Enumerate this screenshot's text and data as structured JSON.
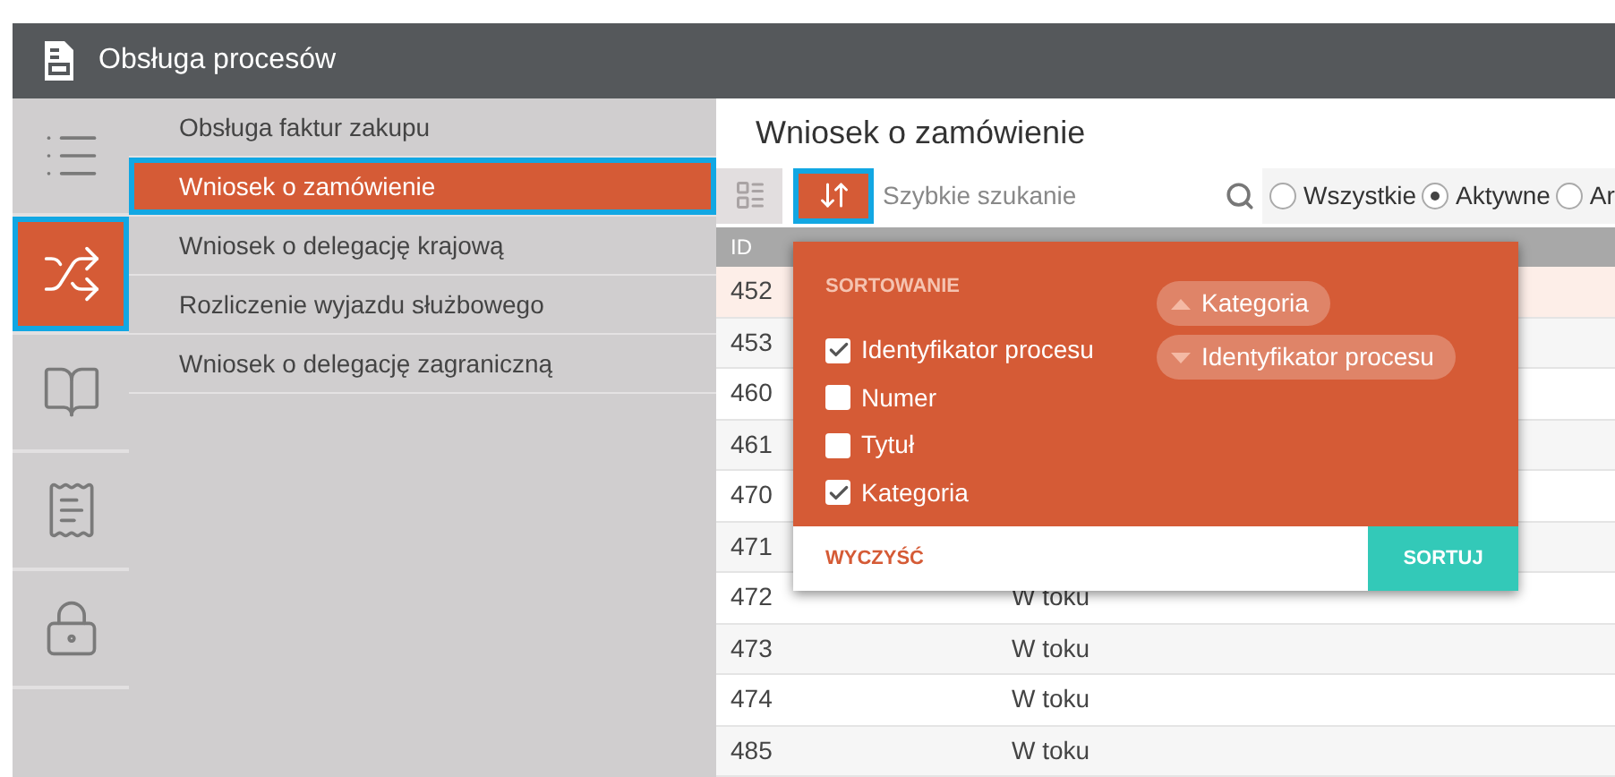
{
  "header": {
    "title": "Obsługa procesów"
  },
  "rail": [
    {
      "kind": "list",
      "selected": false
    },
    {
      "kind": "shuffle",
      "selected": true
    },
    {
      "kind": "book",
      "selected": false
    },
    {
      "kind": "receipt",
      "selected": false
    },
    {
      "kind": "lock",
      "selected": false
    }
  ],
  "submenu": [
    {
      "label": "Obsługa faktur zakupu",
      "selected": false
    },
    {
      "label": "Wniosek o zamówienie",
      "selected": true
    },
    {
      "label": "Wniosek o delegację krajową",
      "selected": false
    },
    {
      "label": "Rozliczenie wyjazdu służbowego",
      "selected": false
    },
    {
      "label": "Wniosek o delegację zagraniczną",
      "selected": false
    }
  ],
  "main": {
    "title": "Wniosek o zamówienie",
    "search": {
      "placeholder": "Szybkie szukanie"
    },
    "filters": [
      {
        "label": "Wszystkie",
        "selected": false
      },
      {
        "label": "Aktywne",
        "selected": true
      },
      {
        "label": "Ar",
        "selected": false
      }
    ],
    "table": {
      "columns": [
        "ID"
      ],
      "rows": [
        {
          "id": "452",
          "selected": true
        },
        {
          "id": "453",
          "selected": false
        },
        {
          "id": "460",
          "selected": false
        },
        {
          "id": "461",
          "selected": false
        },
        {
          "id": "470",
          "selected": false
        },
        {
          "id": "471",
          "selected": false
        },
        {
          "id": "472",
          "status": "W toku",
          "selected": false
        },
        {
          "id": "473",
          "status": "W toku",
          "selected": false
        },
        {
          "id": "474",
          "status": "W toku",
          "selected": false
        },
        {
          "id": "485",
          "status": "W toku",
          "selected": false
        }
      ]
    }
  },
  "sort_popup": {
    "title": "SORTOWANIE",
    "fields": [
      {
        "label": "Identyfikator procesu",
        "checked": true
      },
      {
        "label": "Numer",
        "checked": false
      },
      {
        "label": "Tytuł",
        "checked": false
      },
      {
        "label": "Kategoria",
        "checked": true
      }
    ],
    "order": [
      {
        "label": "Kategoria",
        "descending": false
      },
      {
        "label": "Identyfikator procesu",
        "descending": true
      }
    ],
    "clear": "WYCZYŚĆ",
    "apply": "SORTUJ"
  }
}
